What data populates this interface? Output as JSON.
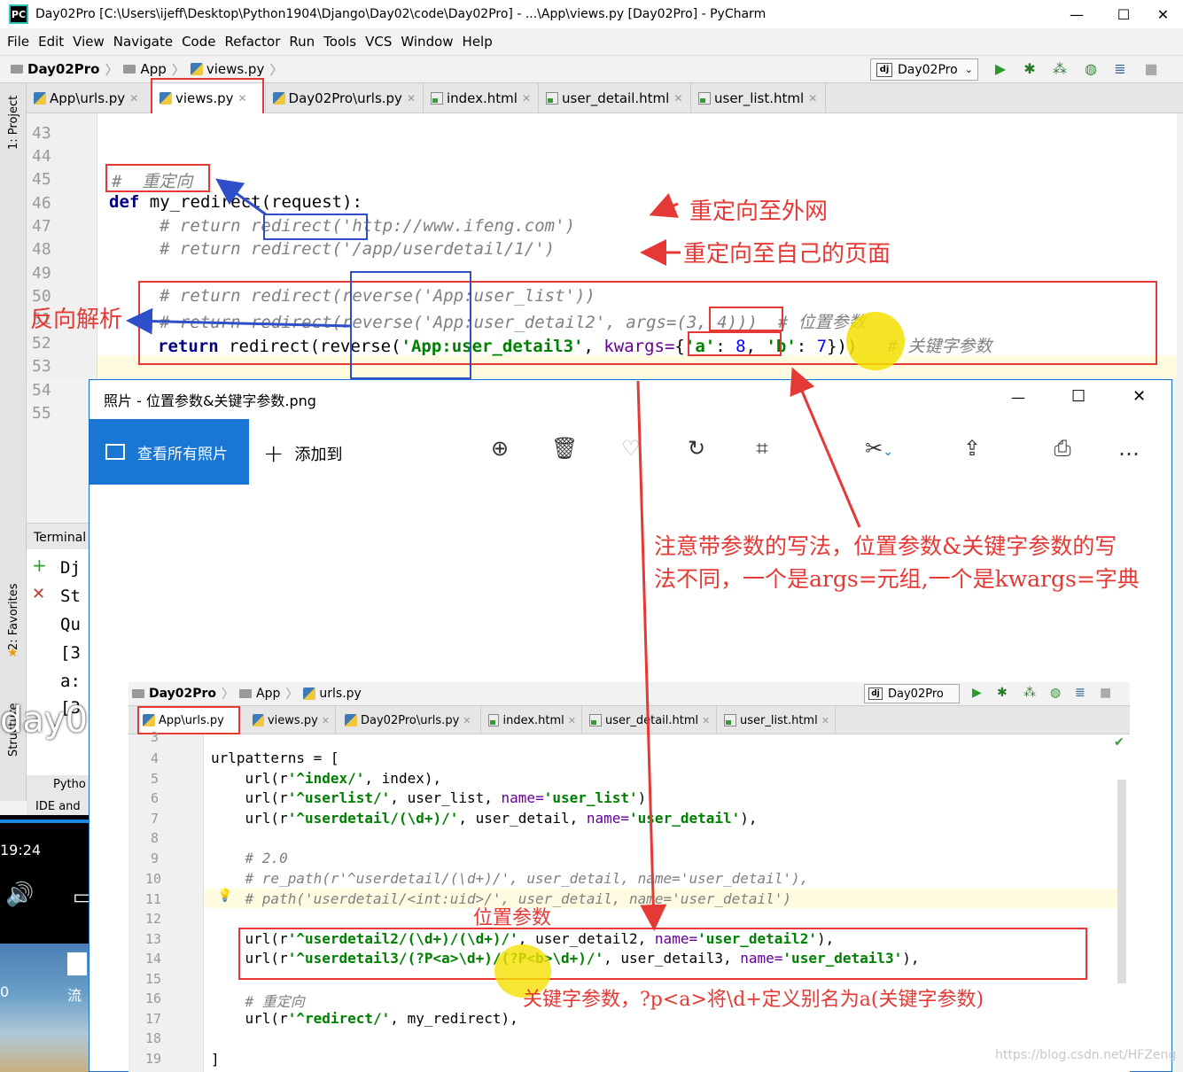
{
  "window": {
    "title": "Day02Pro [C:\\Users\\ijeff\\Desktop\\Python1904\\Django\\Day02\\code\\Day02Pro] - ...\\App\\views.py [Day02Pro] - PyCharm",
    "minimize": "—",
    "maximize": "☐",
    "close": "✕"
  },
  "menu": [
    "File",
    "Edit",
    "View",
    "Navigate",
    "Code",
    "Refactor",
    "Run",
    "Tools",
    "VCS",
    "Window",
    "Help"
  ],
  "breadcrumb": [
    "Day02Pro",
    "App",
    "views.py"
  ],
  "run_config": "Day02Pro",
  "tabs": [
    "App\\urls.py",
    "views.py",
    "Day02Pro\\urls.py",
    "index.html",
    "user_detail.html",
    "user_list.html"
  ],
  "side_labels": {
    "project": "1: Project",
    "favorites": "2: Favorites",
    "structure": "Structure"
  },
  "editor": {
    "lines": [
      "43",
      "44",
      "45",
      "46",
      "47",
      "48",
      "49",
      "50",
      "51",
      "52",
      "53",
      "54",
      "55"
    ],
    "comment_redirect": "#  重定向",
    "def_kw": "def",
    "def_rest": " my_redirect(request):",
    "line47_pre": "# return ",
    "line47_fn": "redirect",
    "line47_post": "('http://www.ifeng.com')",
    "line48": "# return redirect('/app/userdetail/1/')",
    "line50": "# return redirect(reverse('App:user_list'))",
    "line51_pre": "# return redirect(reverse('App:user_detail2', ",
    "line51_args": "args=",
    "line51_post": "(3, 4)))  # 位置参数",
    "line52_kw": "return",
    "line52_a": " redirect(reverse(",
    "line52_str": "'App:user_detail3'",
    "line52_b": ", ",
    "line52_kwargs": "kwargs=",
    "line52_c1": "{",
    "line52_s1": "'a'",
    "line52_c2": ": ",
    "line52_n1": "8",
    "line52_c3": ", ",
    "line52_s2": "'b'",
    "line52_c4": ": ",
    "line52_n2": "7",
    "line52_c5": "}))",
    "line52_cm": "# 关键字参数"
  },
  "annotations": {
    "external": "重定向至外网",
    "own_page": "重定向至自己的页面",
    "reverse": "反向解析",
    "note_line1": "注意带参数的写法，位置参数&关键字参数的写",
    "note_line2": "法不同，一个是args=元组,一个是kwargs=字典",
    "positional": "位置参数",
    "keyword": "关键字参数，?p<a>将\\d+定义别名为a(关键字参数)"
  },
  "terminal": {
    "title": "Terminal",
    "lines": [
      "Dj",
      "St",
      "Qu",
      "[3",
      "a:",
      "[3"
    ],
    "bottom": [
      "Pytho",
      "IDE and"
    ]
  },
  "desktop": {
    "time": "19:24",
    "bigtext": "day0",
    "icon_label": "流",
    "icon_label0": "0"
  },
  "photos": {
    "title": "照片 - 位置参数&关键字参数.png",
    "view_all": "查看所有照片",
    "add_to": "添加到",
    "more": "…"
  },
  "inner": {
    "breadcrumb": [
      "Day02Pro",
      "App",
      "urls.py"
    ],
    "run_config": "Day02Pro",
    "tabs": [
      "App\\urls.py",
      "views.py",
      "Day02Pro\\urls.py",
      "index.html",
      "user_detail.html",
      "user_list.html"
    ],
    "lines": [
      "3",
      "4",
      "5",
      "6",
      "7",
      "8",
      "9",
      "10",
      "11",
      "12",
      "13",
      "14",
      "15",
      "16",
      "17",
      "18",
      "19"
    ],
    "code": {
      "l4": "urlpatterns = [",
      "l5_a": "    url(r",
      "l5_s": "'^index/'",
      "l5_b": ", index),",
      "l6_a": "    url(r",
      "l6_s": "'^userlist/'",
      "l6_b": ", user_list, ",
      "l6_p": "name=",
      "l6_s2": "'user_list'",
      "l6_c": "),",
      "l7_a": "    url(r",
      "l7_s": "'^userdetail/(\\d+)/'",
      "l7_b": ", user_detail, ",
      "l7_p": "name=",
      "l7_s2": "'user_detail'",
      "l7_c": "),",
      "l9": "    # 2.0",
      "l10": "    # re_path(r'^userdetail/(\\d+)/', user_detail, name='user_detail'),",
      "l11": "    # path('userdetail/<int:uid>/', user_detail, name='user_detail')",
      "l13_a": "    url(r",
      "l13_s": "'^userdetail2/(\\d+)/(\\d+)/'",
      "l13_b": ", user_detail2, ",
      "l13_p": "name=",
      "l13_s2": "'user_detail2'",
      "l13_c": "),",
      "l14_a": "    url(r",
      "l14_s": "'^userdetail3/(?P<a>\\d+)/(?P<b>\\d+)/'",
      "l14_b": ", user_detail3, ",
      "l14_p": "name=",
      "l14_s2": "'user_detail3'",
      "l14_c": "),",
      "l16": "    # 重定向",
      "l17_a": "    url(r",
      "l17_s": "'^redirect/'",
      "l17_b": ", my_redirect),",
      "l19": "]"
    }
  },
  "watermark": "https://blog.csdn.net/HFZeng",
  "colors": {
    "red": "#e53935",
    "blue": "#2e4fc9",
    "accent": "#1976d2",
    "highlight": "#f5e000"
  }
}
